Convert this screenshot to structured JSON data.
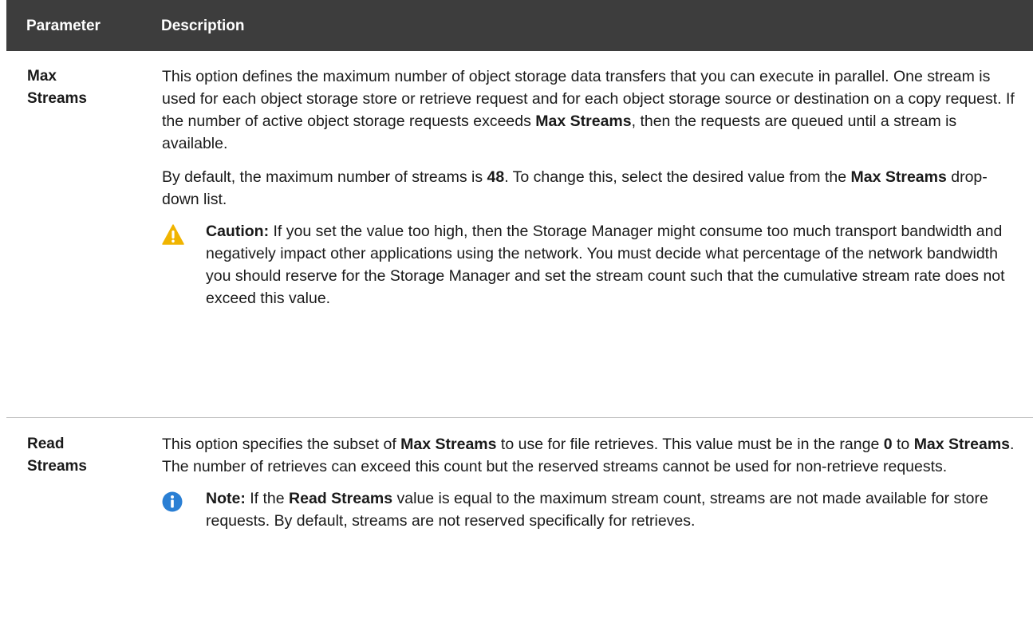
{
  "header": {
    "parameter": "Parameter",
    "description": "Description"
  },
  "rows": [
    {
      "param": "Max Streams",
      "p1": {
        "a": "This option defines the maximum number of object storage data transfers that you can execute in parallel. One stream is used for each object storage store or retrieve request and for each object storage source or destination on a copy request. If the number of active object storage requests exceeds ",
        "b": "Max Streams",
        "c": ", then the requests are queued until a stream is available."
      },
      "p2": {
        "a": "By default, the maximum number of streams is ",
        "b": "48",
        "c": ". To change this, select the desired value from the ",
        "d": "Max Streams",
        "e": " drop-down list."
      },
      "callout": {
        "icon": "warning-icon",
        "color": "#f0b400",
        "label": "Caution:",
        "text": " If you set the value too high, then the Storage Manager might consume too much transport bandwidth and negatively impact other applications using the network. You must decide what percentage of the network bandwidth you should reserve for the Storage Manager and set the stream count such that the cumulative stream rate does not exceed this value."
      }
    },
    {
      "param": "Read Streams",
      "p1": {
        "a": "This option specifies the subset of ",
        "b": "Max Streams",
        "c": " to use for file retrieves. This value must be in the range ",
        "d": "0",
        "e": " to ",
        "f": "Max Streams",
        "g": ". The number of retrieves can exceed this count but the reserved streams cannot be used for non-retrieve requests."
      },
      "callout": {
        "icon": "info-icon",
        "color": "#2a7fd4",
        "label": "Note:",
        "text_a": " If the ",
        "text_b": "Read Streams",
        "text_c": " value is equal to the maximum stream count, streams are not made available for store requests. By default, streams are not reserved specifically for retrieves."
      }
    }
  ]
}
